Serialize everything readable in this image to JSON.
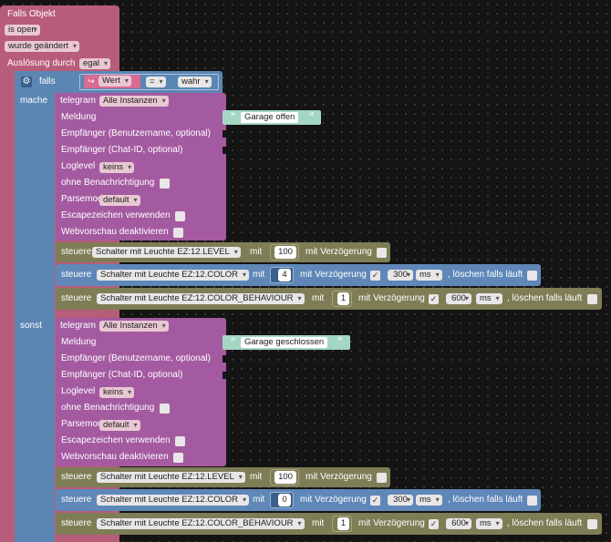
{
  "trigger": {
    "title": "Falls Objekt",
    "state": "is open",
    "change": "wurde geändert",
    "trigger_label": "Auslösung durch",
    "trigger_value": "egal"
  },
  "if_block": {
    "if_label": "falls",
    "value_label": "Wert",
    "operator": "=",
    "compare_value": "wahr",
    "do_label": "mache",
    "else_label": "sonst"
  },
  "telegram_labels": {
    "telegram": "telegram",
    "instances": "Alle Instanzen",
    "message": "Meldung",
    "recipient_user": "Empfänger (Benutzername, optional)",
    "recipient_chat": "Empfänger (Chat-ID, optional)",
    "loglevel": "Loglevel",
    "loglevel_value": "keins",
    "silent": "ohne Benachrichtigung",
    "parsemode": "Parsemode",
    "parsemode_value": "default",
    "escape": "Escapezeichen verwenden",
    "webpreview": "Webvorschau deaktivieren"
  },
  "telegram_1": {
    "message": "Garage offen"
  },
  "telegram_2": {
    "message": "Garage geschlossen"
  },
  "control_labels": {
    "control": "steuere",
    "with": "mit",
    "with_delay": "mit Verzögerung",
    "unit": "ms",
    "clear": ", löschen falls läuft"
  },
  "do_controls": {
    "level_obj": "Schalter mit Leuchte EZ:12.LEVEL",
    "level_val": "100",
    "color_obj": "Schalter mit Leuchte EZ:12.COLOR",
    "color_val": "4",
    "color_delay": "300",
    "behaviour_obj": "Schalter mit Leuchte EZ:12.COLOR_BEHAVIOUR",
    "behaviour_val": "1",
    "behaviour_delay": "600"
  },
  "else_controls": {
    "level_obj": "Schalter mit Leuchte EZ:12.LEVEL",
    "level_val": "100",
    "color_obj": "Schalter mit Leuchte EZ:12.COLOR",
    "color_val": "0",
    "color_delay": "300",
    "behaviour_obj": "Schalter mit Leuchte EZ:12.COLOR_BEHAVIOUR",
    "behaviour_val": "1",
    "behaviour_delay": "600"
  },
  "colors": {
    "trigger": "#b85c7b",
    "logic": "#5b86b4",
    "telegram": "#a45aa0",
    "control": "#7f7d56",
    "control_delay": "#5f87b8",
    "string": "#a4d6c4"
  }
}
